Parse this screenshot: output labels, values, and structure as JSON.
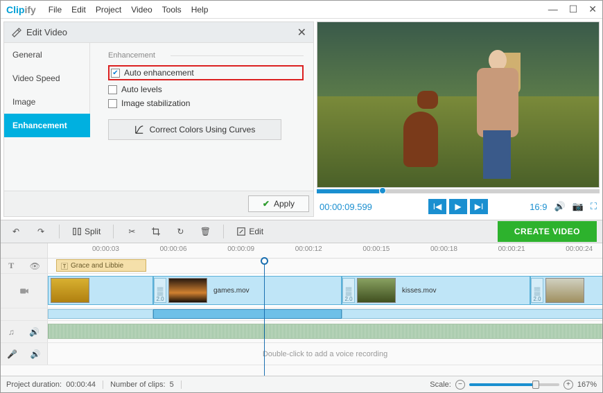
{
  "app": {
    "name": "Clip",
    "name_suffix": "ify"
  },
  "menu": [
    "File",
    "Edit",
    "Project",
    "Video",
    "Tools",
    "Help"
  ],
  "panel": {
    "title": "Edit Video",
    "tabs": [
      "General",
      "Video Speed",
      "Image",
      "Enhancement"
    ],
    "active_tab": 3,
    "fieldset": "Enhancement",
    "options": {
      "auto_enh": {
        "label": "Auto enhancement",
        "checked": true,
        "highlighted": true
      },
      "auto_levels": {
        "label": "Auto levels",
        "checked": false
      },
      "image_stab": {
        "label": "Image stabilization",
        "checked": false
      }
    },
    "curves_btn": "Correct Colors Using Curves",
    "apply": "Apply"
  },
  "preview": {
    "timecode": "00:00:09.599",
    "aspect": "16:9"
  },
  "toolbar": {
    "split": "Split",
    "edit": "Edit",
    "create": "CREATE VIDEO"
  },
  "ruler": {
    "ticks": [
      "00:00:03",
      "00:00:06",
      "00:00:09",
      "00:00:12",
      "00:00:15",
      "00:00:18",
      "00:00:21",
      "00:00:24"
    ],
    "playhead_pct": 36.0
  },
  "text_clip": {
    "label": "Grace and Libbie"
  },
  "video_clips": [
    {
      "left_pct": 0,
      "width_pct": 19,
      "label": "",
      "trans_label": "",
      "thumb_bg": "linear-gradient(#d8b030,#b08010)"
    },
    {
      "left_pct": 19,
      "width_pct": 34,
      "label": "games.mov",
      "trans_label": "2.0",
      "thumb_bg": "linear-gradient(#2a1a10,#d08030 60%,#1a1008)"
    },
    {
      "left_pct": 53,
      "width_pct": 34,
      "label": "kisses.mov",
      "trans_label": "2.0",
      "thumb_bg": "linear-gradient(#88a060,#405020)"
    },
    {
      "left_pct": 87,
      "width_pct": 18,
      "label": "",
      "trans_label": "2.0",
      "thumb_bg": "linear-gradient(#d0d0c0,#a09060)"
    }
  ],
  "sub_bars": [
    {
      "left_pct": 0,
      "width_pct": 19,
      "sel": false
    },
    {
      "left_pct": 19,
      "width_pct": 34,
      "sel": true
    },
    {
      "left_pct": 53,
      "width_pct": 52,
      "sel": false
    }
  ],
  "voice_hint": "Double-click to add a voice recording",
  "status": {
    "duration_label": "Project duration:",
    "duration": "00:00:44",
    "clips_label": "Number of clips:",
    "clips": "5",
    "scale_label": "Scale:",
    "scale_pct": "167%"
  }
}
